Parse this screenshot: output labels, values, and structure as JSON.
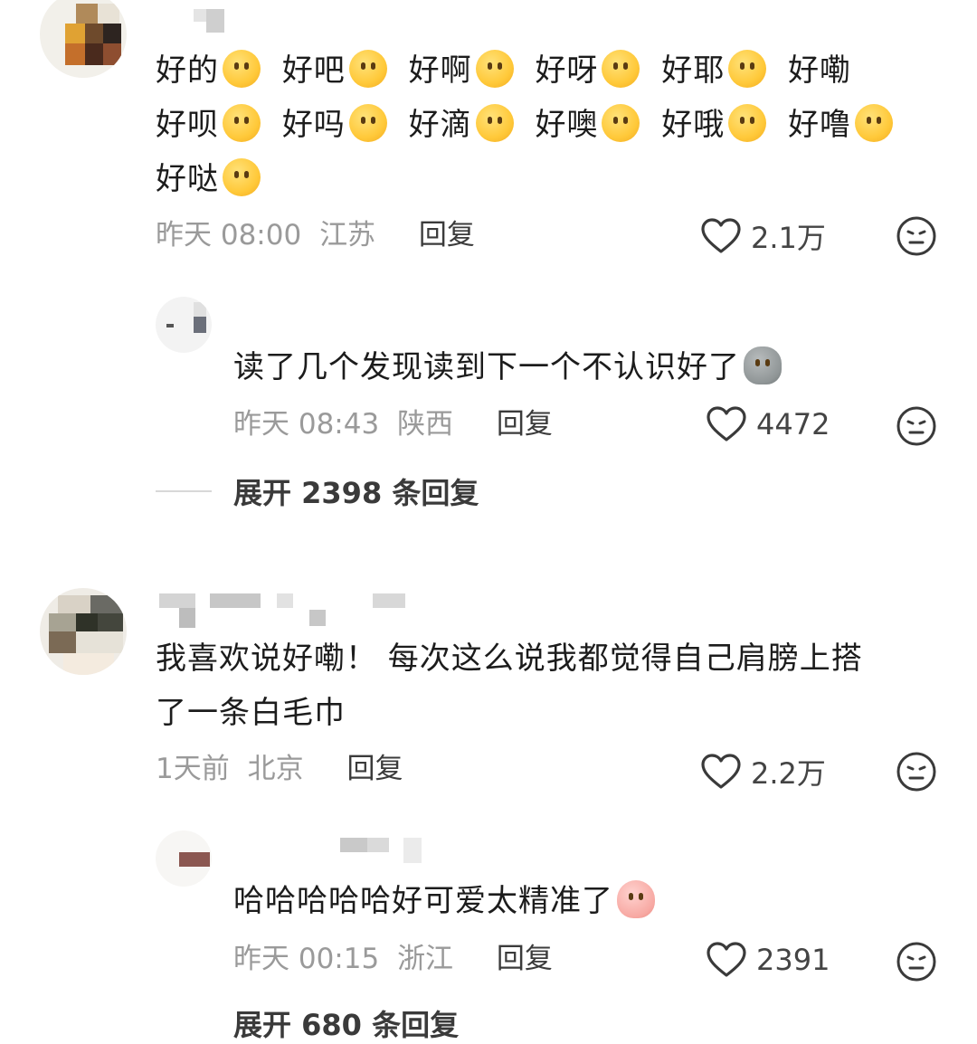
{
  "comments": [
    {
      "text_lines": [
        [
          "好的",
          "好吧",
          "好啊",
          "好呀",
          "好耶",
          "好嘞"
        ],
        [
          "好呗",
          "好吗",
          "好滴",
          "好噢",
          "好哦",
          "好噜"
        ],
        [
          "好哒"
        ]
      ],
      "time": "昨天 08:00",
      "location": "江苏",
      "reply_label": "回复",
      "likes": "2.1万"
    },
    {
      "text": "读了几个发现读到下一个不认识好了",
      "time": "昨天 08:43",
      "location": "陕西",
      "reply_label": "回复",
      "likes": "4472",
      "expand": "展开 2398 条回复"
    },
    {
      "text_line1": "我喜欢说好嘞！ 每次这么说我都觉得自己肩膀上搭",
      "text_line2": "了一条白毛巾",
      "time": "1天前",
      "location": "北京",
      "reply_label": "回复",
      "likes": "2.2万"
    },
    {
      "text": "哈哈哈哈哈好可爱太精准了",
      "time": "昨天 00:15",
      "location": "浙江",
      "reply_label": "回复",
      "likes": "2391",
      "expand": "展开 680 条回复"
    }
  ],
  "icons": {
    "like": "heart-outline-icon",
    "dislike": "meh-face-icon",
    "emoji": "emoji-icon"
  },
  "colors": {
    "text": "#1c1c1c",
    "meta": "#9a9a9a",
    "reply": "#3b3b3b"
  }
}
